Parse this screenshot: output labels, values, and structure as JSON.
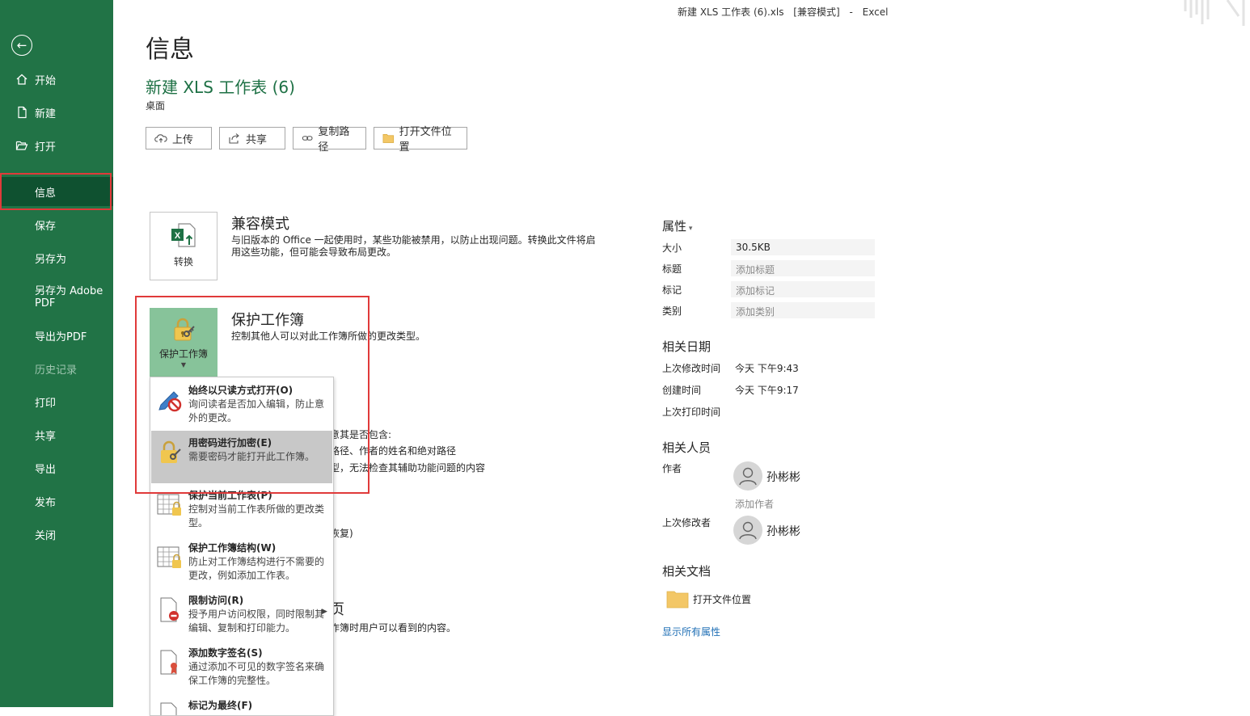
{
  "window": {
    "title": "新建 XLS 工作表 (6).xls",
    "mode": "[兼容模式]",
    "separator": "-",
    "app": "Excel"
  },
  "sidebar": {
    "items": [
      {
        "label": "开始"
      },
      {
        "label": "新建"
      },
      {
        "label": "打开"
      },
      {
        "label": "信息"
      },
      {
        "label": "保存"
      },
      {
        "label": "另存为"
      },
      {
        "label": "另存为 Adobe PDF"
      },
      {
        "label": "导出为PDF"
      },
      {
        "label": "历史记录"
      },
      {
        "label": "打印"
      },
      {
        "label": "共享"
      },
      {
        "label": "导出"
      },
      {
        "label": "发布"
      },
      {
        "label": "关闭"
      }
    ]
  },
  "page": {
    "title": "信息",
    "doc_name": "新建 XLS 工作表 (6)",
    "doc_location": "桌面"
  },
  "actions": {
    "upload": "上传",
    "share": "共享",
    "copy_path": "复制路径",
    "open_location": "打开文件位置"
  },
  "compat": {
    "tile_label": "转换",
    "title": "兼容模式",
    "desc": "与旧版本的 Office 一起使用时，某些功能被禁用，以防止出现问题。转换此文件将启用这些功能，但可能会导致布局更改。"
  },
  "protect": {
    "tile_label": "保护工作簿",
    "title": "保护工作簿",
    "desc": "控制其他人可以对此工作簿所做的更改类型。"
  },
  "background_fragments": {
    "l1": "意其是否包含:",
    "l2": "路径、作者的姓名和绝对路径",
    "l3": "型，无法检查其辅助功能问题的内容",
    "l4": "恢复)",
    "l5": "页",
    "l6": "作簿时用户可以看到的内容。"
  },
  "dropdown": {
    "items": [
      {
        "title": "始终以只读方式打开(O)",
        "desc": "询问读者是否加入编辑，防止意外的更改。"
      },
      {
        "title": "用密码进行加密(E)",
        "desc": "需要密码才能打开此工作簿。"
      },
      {
        "title": "保护当前工作表(P)",
        "desc": "控制对当前工作表所做的更改类型。"
      },
      {
        "title": "保护工作簿结构(W)",
        "desc": "防止对工作簿结构进行不需要的更改，例如添加工作表。"
      },
      {
        "title": "限制访问(R)",
        "desc": "授予用户访问权限，同时限制其编辑、复制和打印能力。"
      },
      {
        "title": "添加数字签名(S)",
        "desc": "通过添加不可见的数字签名来确保工作簿的完整性。"
      },
      {
        "title": "标记为最终(F)",
        "desc": ""
      }
    ]
  },
  "properties": {
    "header": "属性",
    "size_label": "大小",
    "size_value": "30.5KB",
    "title_label": "标题",
    "title_placeholder": "添加标题",
    "tags_label": "标记",
    "tags_placeholder": "添加标记",
    "category_label": "类别",
    "category_placeholder": "添加类别",
    "dates_header": "相关日期",
    "modified_label": "上次修改时间",
    "modified_value": "今天 下午9:43",
    "created_label": "创建时间",
    "created_value": "今天 下午9:17",
    "printed_label": "上次打印时间",
    "people_header": "相关人员",
    "author_label": "作者",
    "author_name": "孙彬彬",
    "add_author": "添加作者",
    "last_modified_by_label": "上次修改者",
    "last_modified_by_name": "孙彬彬",
    "docs_header": "相关文档",
    "open_location": "打开文件位置",
    "show_all": "显示所有属性"
  },
  "colors": {
    "sidebar": "#217346",
    "sidebar_selected": "#0f5130",
    "accent_green": "#1e7145",
    "highlight_red": "#e03a3a",
    "link_blue": "#1f6fb5"
  }
}
